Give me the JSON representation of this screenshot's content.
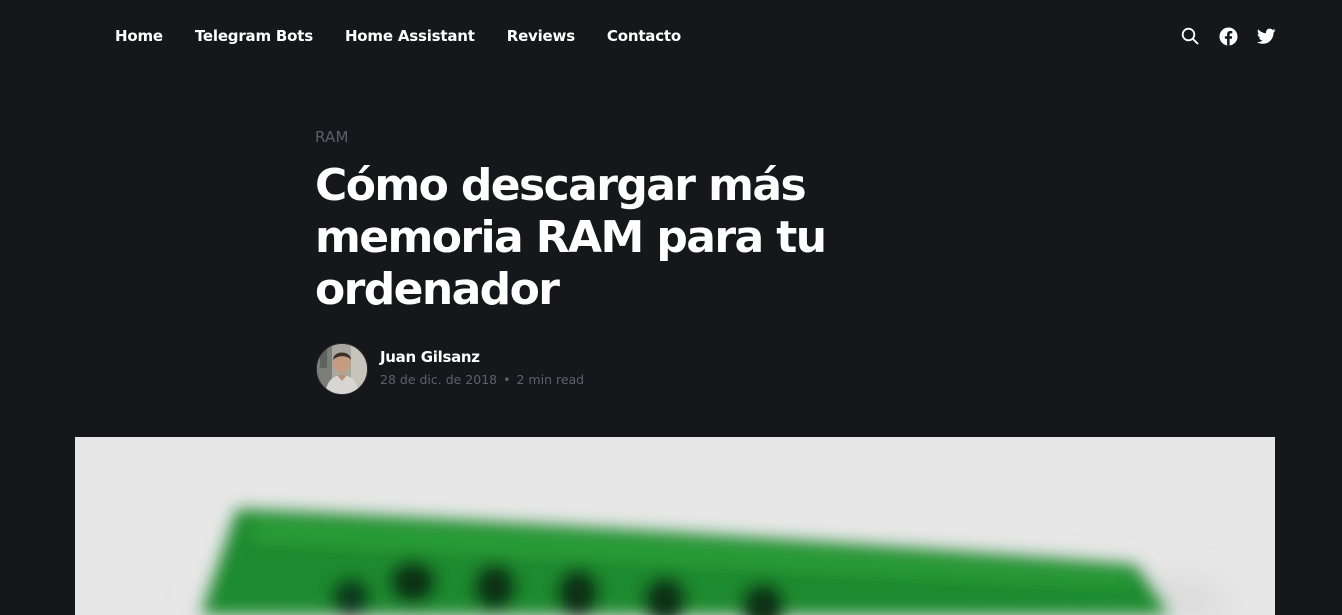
{
  "nav": {
    "links": [
      "Home",
      "Telegram Bots",
      "Home Assistant",
      "Reviews",
      "Contacto"
    ],
    "icons": [
      "search-icon",
      "facebook-icon",
      "twitter-icon"
    ]
  },
  "article": {
    "tag": "RAM",
    "title": "Cómo descargar más memoria RAM para tu ordenador",
    "author": "Juan Gilsanz",
    "date": "28 de dic. de 2018",
    "separator": "•",
    "reading_time": "2 min read"
  },
  "colors": {
    "background": "#15171a",
    "text": "#ffffff",
    "muted": "#5c6066",
    "image_background": "#e6e6e6",
    "ram_green": "#1f8a2e"
  }
}
